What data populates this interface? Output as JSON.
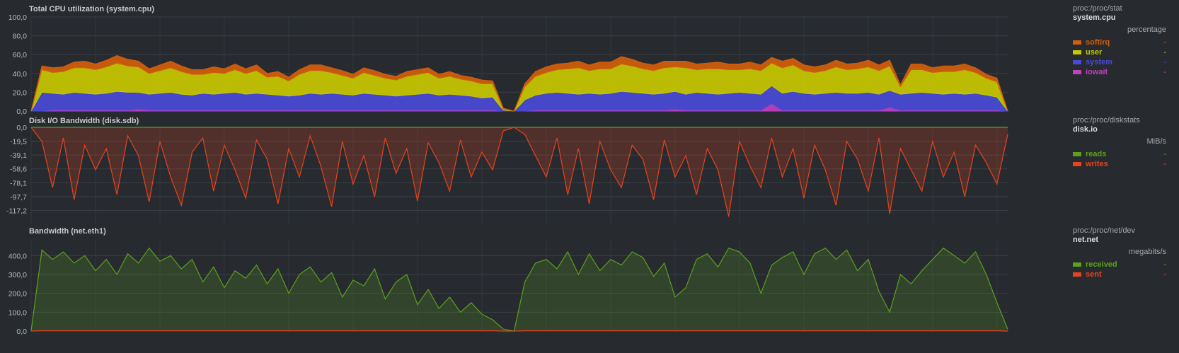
{
  "charts": [
    {
      "title": "Total CPU utilization (system.cpu)",
      "source": "proc:/proc/stat",
      "context": "system.cpu",
      "units": "percentage",
      "legend": [
        {
          "name": "softirq",
          "color": "#d35e0d",
          "value": "-"
        },
        {
          "name": "user",
          "color": "#c8c800",
          "value": "-"
        },
        {
          "name": "system",
          "color": "#4a4ad8",
          "value": "-"
        },
        {
          "name": "iowait",
          "color": "#c040c0",
          "value": "-"
        }
      ]
    },
    {
      "title": "Disk I/O Bandwidth (disk.sdb)",
      "source": "proc:/proc/diskstats",
      "context": "disk.io",
      "units": "MiB/s",
      "legend": [
        {
          "name": "reads",
          "color": "#5ca11a",
          "value": "-"
        },
        {
          "name": "writes",
          "color": "#e8431c",
          "value": "-"
        }
      ]
    },
    {
      "title": "Bandwidth (net.eth1)",
      "source": "proc:/proc/net/dev",
      "context": "net.net",
      "units": "megabits/s",
      "legend": [
        {
          "name": "received",
          "color": "#5ca11a",
          "value": "-"
        },
        {
          "name": "sent",
          "color": "#e8431c",
          "value": "-"
        }
      ]
    }
  ],
  "chart_data": [
    {
      "type": "area",
      "title": "Total CPU utilization (system.cpu)",
      "ylabel": "percentage",
      "ylim": [
        0,
        100
      ],
      "yticks": [
        "0,0",
        "20,0",
        "40,0",
        "60,0",
        "80,0",
        "100,0"
      ],
      "grid": true,
      "legend_placement": "right",
      "stacked": true,
      "series": [
        {
          "name": "iowait",
          "color": "#c040c0",
          "values": [
            0,
            0,
            1,
            1,
            1,
            1,
            1,
            1,
            1,
            1,
            2,
            1,
            1,
            1,
            1,
            1,
            1,
            1,
            1,
            1,
            1,
            1,
            1,
            1,
            1,
            1,
            1,
            1,
            1,
            1,
            1,
            1,
            1,
            1,
            1,
            1,
            1,
            1,
            1,
            1,
            1,
            1,
            1,
            1,
            0,
            0,
            0,
            1,
            1,
            1,
            1,
            1,
            1,
            1,
            1,
            1,
            1,
            1,
            1,
            1,
            2,
            1,
            1,
            1,
            1,
            1,
            1,
            1,
            1,
            8,
            1,
            1,
            1,
            1,
            1,
            1,
            1,
            1,
            1,
            1,
            4,
            1,
            1,
            1,
            1,
            1,
            1,
            1,
            1,
            1,
            1,
            0
          ]
        },
        {
          "name": "system",
          "color": "#4a4ad8",
          "values": [
            0,
            20,
            18,
            17,
            19,
            18,
            17,
            18,
            20,
            19,
            18,
            17,
            18,
            19,
            17,
            16,
            18,
            17,
            18,
            19,
            17,
            18,
            17,
            16,
            15,
            16,
            18,
            17,
            18,
            17,
            16,
            18,
            17,
            16,
            15,
            16,
            17,
            18,
            16,
            17,
            16,
            15,
            13,
            14,
            1,
            0,
            12,
            16,
            18,
            19,
            18,
            17,
            18,
            17,
            18,
            20,
            19,
            18,
            17,
            18,
            19,
            17,
            19,
            18,
            17,
            18,
            19,
            18,
            17,
            19,
            18,
            20,
            18,
            17,
            18,
            19,
            18,
            18,
            19,
            17,
            18,
            17,
            18,
            19,
            18,
            17,
            18,
            17,
            18,
            16,
            14,
            0
          ]
        },
        {
          "name": "user",
          "color": "#c8c800",
          "values": [
            0,
            24,
            22,
            24,
            26,
            27,
            26,
            28,
            30,
            28,
            27,
            22,
            24,
            26,
            24,
            22,
            20,
            23,
            21,
            24,
            22,
            24,
            18,
            20,
            16,
            22,
            24,
            25,
            22,
            20,
            18,
            22,
            20,
            18,
            17,
            20,
            21,
            22,
            18,
            19,
            17,
            16,
            15,
            14,
            1,
            0,
            14,
            20,
            22,
            24,
            26,
            28,
            24,
            27,
            26,
            29,
            28,
            26,
            25,
            27,
            26,
            28,
            24,
            26,
            27,
            25,
            24,
            26,
            25,
            24,
            27,
            28,
            24,
            23,
            24,
            27,
            25,
            26,
            27,
            25,
            26,
            8,
            25,
            24,
            22,
            24,
            23,
            26,
            22,
            18,
            16,
            0
          ]
        },
        {
          "name": "softirq",
          "color": "#d35e0d",
          "values": [
            0,
            4,
            5,
            5,
            6,
            7,
            6,
            7,
            8,
            7,
            6,
            5,
            6,
            7,
            6,
            5,
            5,
            6,
            5,
            6,
            5,
            6,
            4,
            5,
            4,
            5,
            6,
            6,
            5,
            5,
            4,
            5,
            5,
            4,
            4,
            5,
            5,
            5,
            4,
            5,
            4,
            4,
            4,
            3,
            1,
            0,
            3,
            5,
            6,
            6,
            6,
            7,
            6,
            7,
            7,
            8,
            7,
            6,
            6,
            7,
            6,
            7,
            6,
            6,
            7,
            6,
            6,
            7,
            6,
            6,
            7,
            7,
            6,
            6,
            6,
            7,
            6,
            6,
            7,
            6,
            6,
            2,
            6,
            6,
            5,
            6,
            6,
            6,
            5,
            4,
            4,
            0
          ]
        }
      ]
    },
    {
      "type": "area",
      "title": "Disk I/O Bandwidth (disk.sdb)",
      "ylabel": "MiB/s",
      "ylim": [
        -136.7,
        0
      ],
      "yticks": [
        "0,0",
        "-19,5",
        "-39,1",
        "-58,6",
        "-78,1",
        "-97,7",
        "-117,2"
      ],
      "grid": true,
      "legend_placement": "right",
      "series": [
        {
          "name": "reads",
          "color": "#5ca11a",
          "values": [
            0,
            0,
            0,
            0,
            0,
            0,
            0,
            0,
            0,
            0,
            0,
            0,
            0,
            0,
            0,
            0,
            0,
            0,
            0,
            0,
            0,
            0,
            0,
            0,
            0,
            0,
            0,
            0,
            0,
            0,
            0,
            0,
            0,
            0,
            0,
            0,
            0,
            0,
            0,
            0,
            0,
            0,
            0,
            0,
            0,
            0,
            0,
            0,
            0,
            0,
            0,
            0,
            0,
            0,
            0,
            0,
            0,
            0,
            0,
            0,
            0,
            0,
            0,
            0,
            0,
            0,
            0,
            0,
            0,
            0,
            0,
            0,
            0,
            0,
            0,
            0,
            0,
            0,
            0,
            0,
            0,
            0,
            0,
            0,
            0,
            0,
            0,
            0,
            0,
            0,
            0,
            0
          ]
        },
        {
          "name": "writes",
          "color": "#e8431c",
          "values": [
            0,
            -20,
            -85,
            -15,
            -102,
            -25,
            -60,
            -30,
            -95,
            -12,
            -40,
            -105,
            -20,
            -70,
            -110,
            -35,
            -15,
            -90,
            -25,
            -60,
            -100,
            -18,
            -45,
            -108,
            -30,
            -70,
            -12,
            -55,
            -112,
            -20,
            -80,
            -40,
            -98,
            -15,
            -65,
            -30,
            -104,
            -22,
            -50,
            -90,
            -18,
            -70,
            -35,
            -60,
            -5,
            0,
            -10,
            -40,
            -70,
            -15,
            -95,
            -30,
            -108,
            -20,
            -60,
            -85,
            -25,
            -45,
            -102,
            -18,
            -70,
            -40,
            -95,
            -30,
            -60,
            -126,
            -20,
            -55,
            -85,
            -15,
            -70,
            -30,
            -100,
            -25,
            -60,
            -110,
            -20,
            -45,
            -90,
            -15,
            -122,
            -30,
            -60,
            -90,
            -20,
            -70,
            -35,
            -98,
            -25,
            -50,
            -80,
            -10
          ]
        }
      ]
    },
    {
      "type": "area",
      "title": "Bandwidth (net.eth1)",
      "ylabel": "megabits/s",
      "ylim": [
        0,
        480
      ],
      "yticks": [
        "0,0",
        "100,0",
        "200,0",
        "300,0",
        "400,0"
      ],
      "grid": true,
      "legend_placement": "right",
      "series": [
        {
          "name": "received",
          "color": "#5ca11a",
          "values": [
            0,
            430,
            380,
            420,
            360,
            400,
            320,
            380,
            300,
            410,
            360,
            440,
            370,
            400,
            330,
            380,
            260,
            340,
            230,
            320,
            280,
            350,
            250,
            330,
            200,
            300,
            340,
            260,
            310,
            180,
            270,
            240,
            330,
            170,
            260,
            300,
            140,
            220,
            120,
            180,
            100,
            150,
            90,
            60,
            10,
            0,
            260,
            360,
            380,
            330,
            420,
            300,
            410,
            320,
            380,
            350,
            420,
            390,
            290,
            360,
            180,
            230,
            380,
            410,
            340,
            440,
            420,
            360,
            200,
            350,
            390,
            420,
            300,
            410,
            440,
            380,
            430,
            320,
            380,
            210,
            100,
            300,
            250,
            320,
            380,
            440,
            400,
            360,
            420,
            300,
            150,
            10
          ]
        },
        {
          "name": "sent",
          "color": "#e8431c",
          "values": [
            0,
            2,
            2,
            2,
            2,
            2,
            2,
            2,
            2,
            2,
            2,
            2,
            2,
            2,
            2,
            2,
            2,
            2,
            2,
            2,
            2,
            2,
            2,
            2,
            2,
            2,
            2,
            2,
            2,
            2,
            2,
            2,
            2,
            2,
            2,
            2,
            2,
            2,
            2,
            2,
            2,
            2,
            2,
            2,
            0,
            0,
            2,
            2,
            2,
            2,
            2,
            2,
            2,
            2,
            2,
            2,
            2,
            2,
            2,
            2,
            2,
            2,
            2,
            2,
            2,
            2,
            2,
            2,
            2,
            2,
            2,
            2,
            2,
            2,
            2,
            2,
            2,
            2,
            2,
            2,
            2,
            2,
            2,
            2,
            2,
            2,
            2,
            2,
            2,
            2,
            2,
            0
          ]
        }
      ]
    }
  ]
}
